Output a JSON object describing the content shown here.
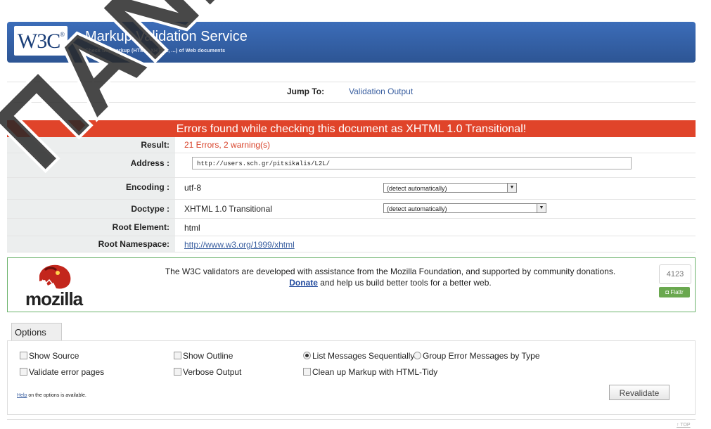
{
  "header": {
    "logo_text": "W3C",
    "logo_mark": "®",
    "title": "Markup Validation Service",
    "subtitle": "Check the markup (HTML, XHTML, ...) of Web documents"
  },
  "jump": {
    "label": "Jump To:",
    "link": "Validation Output"
  },
  "result": {
    "banner": "Errors found while checking this document as XHTML 1.0 Transitional!",
    "rows": {
      "result_label": "Result:",
      "result_value": "21 Errors, 2 warning(s)",
      "address_label": "Address :",
      "address_value": "http://users.sch.gr/pitsikalis/L2L/",
      "encoding_label": "Encoding :",
      "encoding_value": "utf-8",
      "encoding_select": "(detect automatically)",
      "doctype_label": "Doctype :",
      "doctype_value": "XHTML 1.0 Transitional",
      "doctype_select": "(detect automatically)",
      "root_label": "Root Element:",
      "root_value": "html",
      "ns_label": "Root Namespace:",
      "ns_value": "http://www.w3.org/1999/xhtml"
    }
  },
  "mozilla": {
    "text1": "The W3C validators are developed with assistance from the Mozilla Foundation, and supported by community donations.",
    "donate": "Donate",
    "text2": " and help us build better tools for a better web.",
    "word": "mozilla",
    "count": "4123",
    "flattr": "Flattr"
  },
  "options": {
    "tab": "Options",
    "show_source": "Show Source",
    "show_outline": "Show Outline",
    "list_seq": "List Messages Sequentially",
    "group_err": "Group Error Messages by Type",
    "validate_err": "Validate error pages",
    "verbose": "Verbose Output",
    "tidy": "Clean up Markup with HTML-Tidy",
    "help_link": "Help",
    "help_rest": " on the options is available.",
    "revalidate": "Revalidate"
  },
  "footer": {
    "top": "↑ TOP"
  },
  "watermark": "ΠΑΝΕΠΙΣΤ",
  "colors": {
    "banner": "#3461a8",
    "error": "#e0442a",
    "mozilla_border": "#6cb36c"
  }
}
